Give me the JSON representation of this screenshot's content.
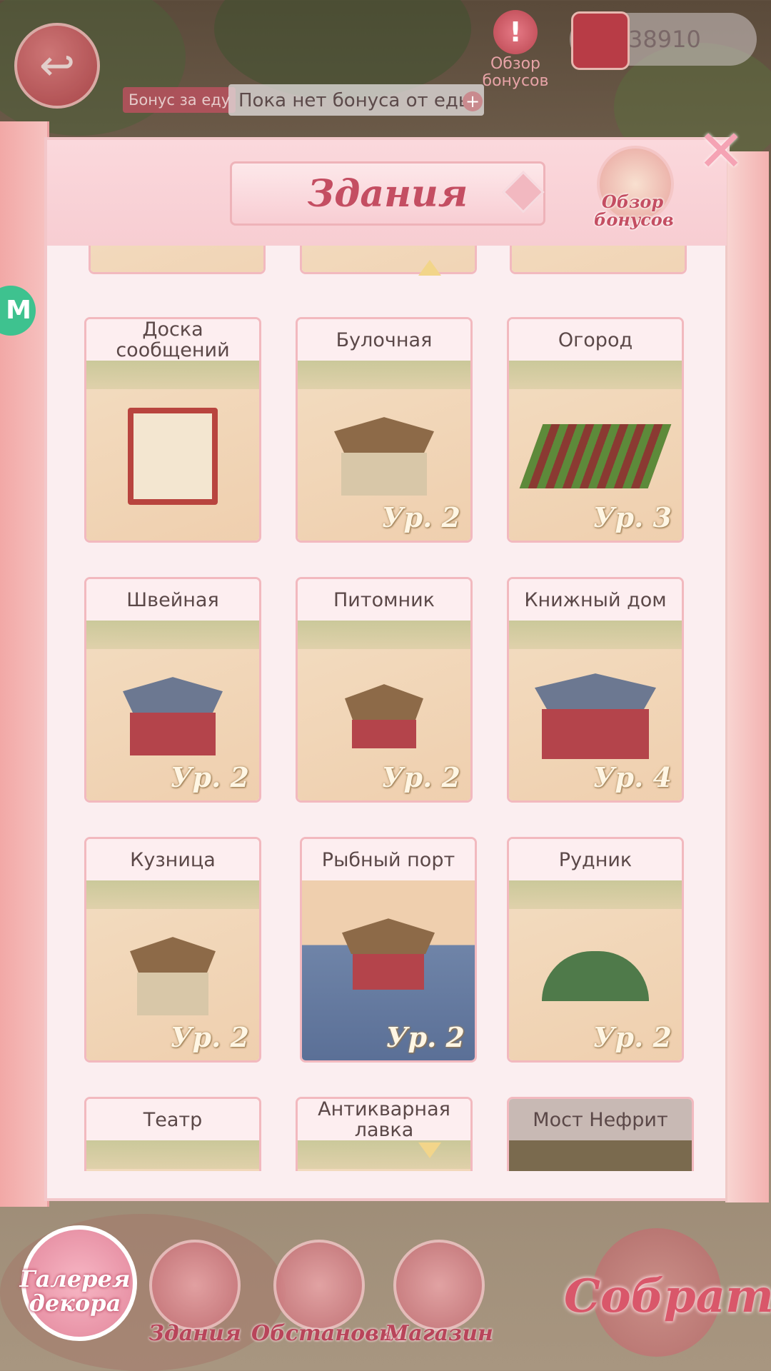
{
  "top": {
    "coins": "38910",
    "bonus_overview": "Обзор бонусов",
    "food_bonus_label": "Бонус за еду",
    "food_bonus_value": "Пока нет бонуса от еды"
  },
  "panel": {
    "title": "Здания",
    "bonus_overview": "Обзор бонусов"
  },
  "buildings": [
    {
      "name": "Доска сообщений",
      "level": ""
    },
    {
      "name": "Булочная",
      "level": "Ур. 2"
    },
    {
      "name": "Огород",
      "level": "Ур. 3"
    },
    {
      "name": "Швейная",
      "level": "Ур. 2"
    },
    {
      "name": "Питомник",
      "level": "Ур. 2"
    },
    {
      "name": "Книжный дом",
      "level": "Ур. 4"
    },
    {
      "name": "Кузница",
      "level": "Ур. 2"
    },
    {
      "name": "Рыбный порт",
      "level": "Ур. 2"
    },
    {
      "name": "Рудник",
      "level": "Ур. 2"
    },
    {
      "name": "Театр",
      "level": ""
    },
    {
      "name": "Антикварная лавка",
      "level": ""
    },
    {
      "name": "Мост Нефрит",
      "level": ""
    }
  ],
  "nav": {
    "gallery": "Галерея декора",
    "buildings": "Здания",
    "furnishing": "Обстановка",
    "shop": "Магазин",
    "collect": "Собрать"
  },
  "colors": {
    "accent": "#c44e62",
    "panel_bg": "#fbeef0",
    "card_border": "#f2b9bf"
  }
}
